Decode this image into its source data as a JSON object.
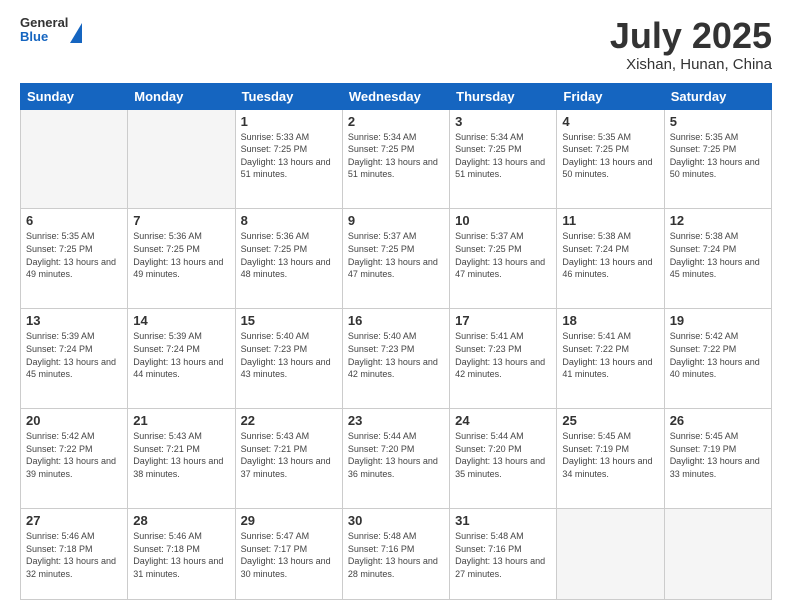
{
  "header": {
    "logo": {
      "line1": "General",
      "line2": "Blue"
    },
    "title": "July 2025",
    "location": "Xishan, Hunan, China"
  },
  "weekdays": [
    "Sunday",
    "Monday",
    "Tuesday",
    "Wednesday",
    "Thursday",
    "Friday",
    "Saturday"
  ],
  "weeks": [
    [
      {
        "day": "",
        "info": ""
      },
      {
        "day": "",
        "info": ""
      },
      {
        "day": "1",
        "info": "Sunrise: 5:33 AM\nSunset: 7:25 PM\nDaylight: 13 hours and 51 minutes."
      },
      {
        "day": "2",
        "info": "Sunrise: 5:34 AM\nSunset: 7:25 PM\nDaylight: 13 hours and 51 minutes."
      },
      {
        "day": "3",
        "info": "Sunrise: 5:34 AM\nSunset: 7:25 PM\nDaylight: 13 hours and 51 minutes."
      },
      {
        "day": "4",
        "info": "Sunrise: 5:35 AM\nSunset: 7:25 PM\nDaylight: 13 hours and 50 minutes."
      },
      {
        "day": "5",
        "info": "Sunrise: 5:35 AM\nSunset: 7:25 PM\nDaylight: 13 hours and 50 minutes."
      }
    ],
    [
      {
        "day": "6",
        "info": "Sunrise: 5:35 AM\nSunset: 7:25 PM\nDaylight: 13 hours and 49 minutes."
      },
      {
        "day": "7",
        "info": "Sunrise: 5:36 AM\nSunset: 7:25 PM\nDaylight: 13 hours and 49 minutes."
      },
      {
        "day": "8",
        "info": "Sunrise: 5:36 AM\nSunset: 7:25 PM\nDaylight: 13 hours and 48 minutes."
      },
      {
        "day": "9",
        "info": "Sunrise: 5:37 AM\nSunset: 7:25 PM\nDaylight: 13 hours and 47 minutes."
      },
      {
        "day": "10",
        "info": "Sunrise: 5:37 AM\nSunset: 7:25 PM\nDaylight: 13 hours and 47 minutes."
      },
      {
        "day": "11",
        "info": "Sunrise: 5:38 AM\nSunset: 7:24 PM\nDaylight: 13 hours and 46 minutes."
      },
      {
        "day": "12",
        "info": "Sunrise: 5:38 AM\nSunset: 7:24 PM\nDaylight: 13 hours and 45 minutes."
      }
    ],
    [
      {
        "day": "13",
        "info": "Sunrise: 5:39 AM\nSunset: 7:24 PM\nDaylight: 13 hours and 45 minutes."
      },
      {
        "day": "14",
        "info": "Sunrise: 5:39 AM\nSunset: 7:24 PM\nDaylight: 13 hours and 44 minutes."
      },
      {
        "day": "15",
        "info": "Sunrise: 5:40 AM\nSunset: 7:23 PM\nDaylight: 13 hours and 43 minutes."
      },
      {
        "day": "16",
        "info": "Sunrise: 5:40 AM\nSunset: 7:23 PM\nDaylight: 13 hours and 42 minutes."
      },
      {
        "day": "17",
        "info": "Sunrise: 5:41 AM\nSunset: 7:23 PM\nDaylight: 13 hours and 42 minutes."
      },
      {
        "day": "18",
        "info": "Sunrise: 5:41 AM\nSunset: 7:22 PM\nDaylight: 13 hours and 41 minutes."
      },
      {
        "day": "19",
        "info": "Sunrise: 5:42 AM\nSunset: 7:22 PM\nDaylight: 13 hours and 40 minutes."
      }
    ],
    [
      {
        "day": "20",
        "info": "Sunrise: 5:42 AM\nSunset: 7:22 PM\nDaylight: 13 hours and 39 minutes."
      },
      {
        "day": "21",
        "info": "Sunrise: 5:43 AM\nSunset: 7:21 PM\nDaylight: 13 hours and 38 minutes."
      },
      {
        "day": "22",
        "info": "Sunrise: 5:43 AM\nSunset: 7:21 PM\nDaylight: 13 hours and 37 minutes."
      },
      {
        "day": "23",
        "info": "Sunrise: 5:44 AM\nSunset: 7:20 PM\nDaylight: 13 hours and 36 minutes."
      },
      {
        "day": "24",
        "info": "Sunrise: 5:44 AM\nSunset: 7:20 PM\nDaylight: 13 hours and 35 minutes."
      },
      {
        "day": "25",
        "info": "Sunrise: 5:45 AM\nSunset: 7:19 PM\nDaylight: 13 hours and 34 minutes."
      },
      {
        "day": "26",
        "info": "Sunrise: 5:45 AM\nSunset: 7:19 PM\nDaylight: 13 hours and 33 minutes."
      }
    ],
    [
      {
        "day": "27",
        "info": "Sunrise: 5:46 AM\nSunset: 7:18 PM\nDaylight: 13 hours and 32 minutes."
      },
      {
        "day": "28",
        "info": "Sunrise: 5:46 AM\nSunset: 7:18 PM\nDaylight: 13 hours and 31 minutes."
      },
      {
        "day": "29",
        "info": "Sunrise: 5:47 AM\nSunset: 7:17 PM\nDaylight: 13 hours and 30 minutes."
      },
      {
        "day": "30",
        "info": "Sunrise: 5:48 AM\nSunset: 7:16 PM\nDaylight: 13 hours and 28 minutes."
      },
      {
        "day": "31",
        "info": "Sunrise: 5:48 AM\nSunset: 7:16 PM\nDaylight: 13 hours and 27 minutes."
      },
      {
        "day": "",
        "info": ""
      },
      {
        "day": "",
        "info": ""
      }
    ]
  ]
}
